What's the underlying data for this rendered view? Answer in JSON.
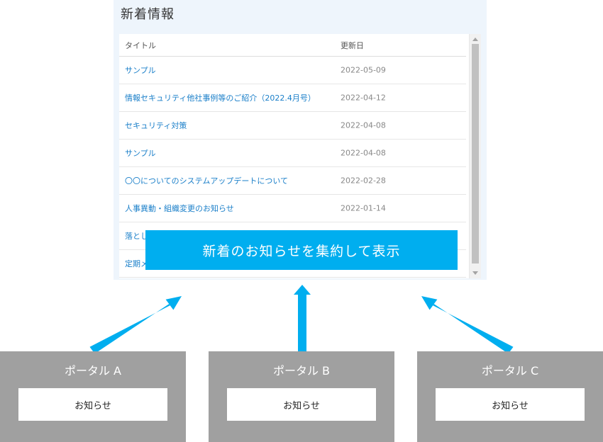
{
  "news": {
    "title": "新着情報",
    "header": {
      "title": "タイトル",
      "date": "更新日"
    },
    "rows": [
      {
        "title": "サンプル",
        "date": "2022-05-09"
      },
      {
        "title": "情報セキュリティ他社事例等のご紹介（2022.4月号）",
        "date": "2022-04-12"
      },
      {
        "title": "セキュリティ対策",
        "date": "2022-04-08"
      },
      {
        "title": "サンプル",
        "date": "2022-04-08"
      },
      {
        "title": "〇〇についてのシステムアップデートについて",
        "date": "2022-02-28"
      },
      {
        "title": "人事異動・組織変更のお知らせ",
        "date": "2022-01-14"
      },
      {
        "title": "落とし",
        "date": ""
      },
      {
        "title": "定期メ",
        "date": ""
      }
    ]
  },
  "callout": "新着のお知らせを集約して表示",
  "portals": [
    {
      "label": "ポータル A",
      "notice": "お知らせ"
    },
    {
      "label": "ポータル B",
      "notice": "お知らせ"
    },
    {
      "label": "ポータル C",
      "notice": "お知らせ"
    }
  ],
  "colors": {
    "accent": "#00aeef",
    "link": "#1a7fc9",
    "portal": "#a0a0a0",
    "panel": "#eef5fc"
  }
}
